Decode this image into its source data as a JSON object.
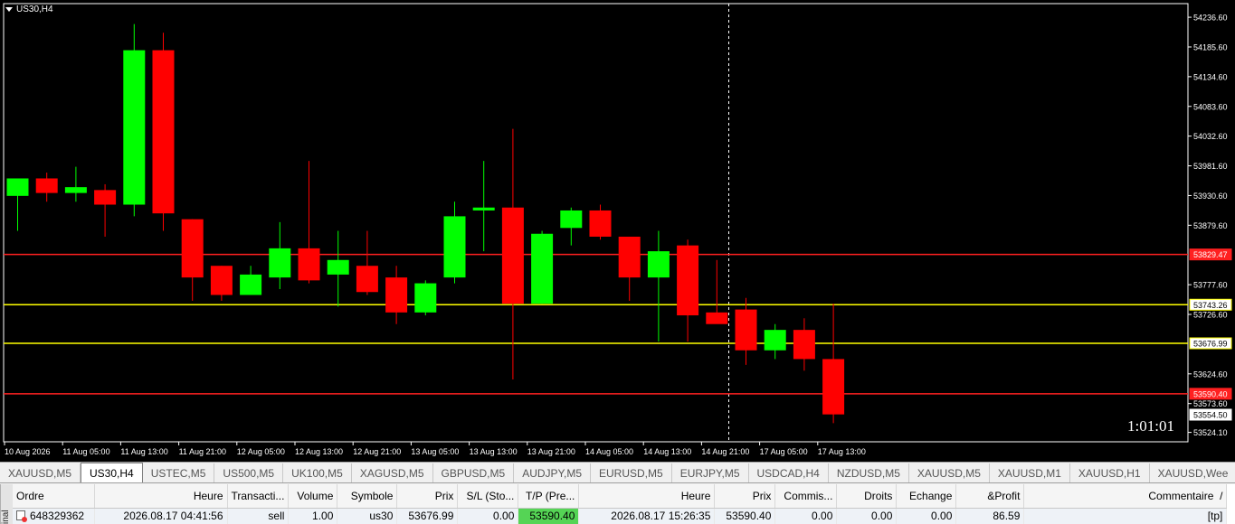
{
  "chart": {
    "symbol": "US30,H4",
    "timer": "1:01:01",
    "price_labels": [
      "54236.60",
      "54185.60",
      "54134.60",
      "54083.60",
      "54032.60",
      "53981.60",
      "53930.60",
      "53879.60",
      "53777.60",
      "53726.60",
      "53624.60",
      "53573.60",
      "53524.10"
    ],
    "time_labels": [
      "10 Aug 2026",
      "11 Aug 05:00",
      "11 Aug 13:00",
      "11 Aug 21:00",
      "12 Aug 05:00",
      "12 Aug 13:00",
      "12 Aug 21:00",
      "13 Aug 05:00",
      "13 Aug 13:00",
      "13 Aug 21:00",
      "14 Aug 05:00",
      "14 Aug 13:00",
      "14 Aug 21:00",
      "17 Aug 05:00",
      "17 Aug 13:00"
    ],
    "horizontal_lines": [
      {
        "label": "53829.47",
        "color": "#ff2020"
      },
      {
        "label": "53743.26",
        "color": "#ffff00"
      },
      {
        "label": "53676.99",
        "color": "#ffff00"
      },
      {
        "label": "53590.40",
        "color": "#ff2020"
      }
    ],
    "current_price": "53554.50",
    "colors": {
      "bull": "#00ff00",
      "bear": "#ff0000",
      "background": "#000000",
      "axis": "#ffffff"
    }
  },
  "chart_data": {
    "type": "candlestick",
    "timeframe": "H4",
    "candles": [
      {
        "o": 53930,
        "h": 53960,
        "l": 53870,
        "c": 53960
      },
      {
        "o": 53960,
        "h": 53970,
        "l": 53920,
        "c": 53935
      },
      {
        "o": 53935,
        "h": 53980,
        "l": 53920,
        "c": 53945
      },
      {
        "o": 53940,
        "h": 53950,
        "l": 53860,
        "c": 53915
      },
      {
        "o": 53915,
        "h": 54225,
        "l": 53895,
        "c": 54180
      },
      {
        "o": 54180,
        "h": 54210,
        "l": 53870,
        "c": 53900
      },
      {
        "o": 53890,
        "h": 53890,
        "l": 53750,
        "c": 53790
      },
      {
        "o": 53810,
        "h": 53810,
        "l": 53750,
        "c": 53760
      },
      {
        "o": 53760,
        "h": 53810,
        "l": 53760,
        "c": 53795
      },
      {
        "o": 53790,
        "h": 53885,
        "l": 53770,
        "c": 53840
      },
      {
        "o": 53840,
        "h": 53990,
        "l": 53780,
        "c": 53785
      },
      {
        "o": 53795,
        "h": 53870,
        "l": 53740,
        "c": 53820
      },
      {
        "o": 53810,
        "h": 53870,
        "l": 53760,
        "c": 53765
      },
      {
        "o": 53790,
        "h": 53810,
        "l": 53710,
        "c": 53730
      },
      {
        "o": 53730,
        "h": 53785,
        "l": 53725,
        "c": 53780
      },
      {
        "o": 53790,
        "h": 53920,
        "l": 53780,
        "c": 53895
      },
      {
        "o": 53905,
        "h": 53990,
        "l": 53835,
        "c": 53910
      },
      {
        "o": 53910,
        "h": 54045,
        "l": 53615,
        "c": 53745
      },
      {
        "o": 53745,
        "h": 53870,
        "l": 53745,
        "c": 53865
      },
      {
        "o": 53875,
        "h": 53910,
        "l": 53845,
        "c": 53905
      },
      {
        "o": 53905,
        "h": 53915,
        "l": 53855,
        "c": 53860
      },
      {
        "o": 53860,
        "h": 53860,
        "l": 53750,
        "c": 53790
      },
      {
        "o": 53790,
        "h": 53870,
        "l": 53680,
        "c": 53835
      },
      {
        "o": 53845,
        "h": 53855,
        "l": 53680,
        "c": 53725
      },
      {
        "o": 53730,
        "h": 53820,
        "l": 53720,
        "c": 53710
      },
      {
        "o": 53735,
        "h": 53755,
        "l": 53640,
        "c": 53665
      },
      {
        "o": 53665,
        "h": 53710,
        "l": 53650,
        "c": 53700
      },
      {
        "o": 53700,
        "h": 53720,
        "l": 53630,
        "c": 53650
      },
      {
        "o": 53650,
        "h": 53745,
        "l": 53540,
        "c": 53555
      }
    ]
  },
  "symbol_tabs": [
    "XAUUSD,M5",
    "US30,H4",
    "USTEC,M5",
    "US500,M5",
    "UK100,M5",
    "XAGUSD,M5",
    "GBPUSD,M5",
    "AUDJPY,M5",
    "EURUSD,M5",
    "EURJPY,M5",
    "USDCAD,H4",
    "NZDUSD,M5",
    "XAUUSD,M5",
    "XAUUSD,M1",
    "XAUUSD,H1",
    "XAUUSD,Wee"
  ],
  "active_tab_index": 1,
  "terminal": {
    "side_label": "inal",
    "columns": [
      "Ordre",
      "Heure",
      "Transacti...",
      "Volume",
      "Symbole",
      "Prix",
      "S/L (Sto...",
      "T/P (Pre...",
      "Heure",
      "Prix",
      "Commis...",
      "Droits",
      "Echange",
      "&Profit",
      "Commentaire"
    ],
    "sort_indicator": "/",
    "row": {
      "ordre": "648329362",
      "heure_open": "2026.08.17 04:41:56",
      "transaction": "sell",
      "volume": "1.00",
      "symbole": "us30",
      "prix_open": "53676.99",
      "sl": "0.00",
      "tp": "53590.40",
      "heure_close": "2026.08.17 15:26:35",
      "prix_close": "53590.40",
      "commission": "0.00",
      "droits": "0.00",
      "echange": "0.00",
      "profit": "86.59",
      "commentaire": "[tp]"
    }
  }
}
